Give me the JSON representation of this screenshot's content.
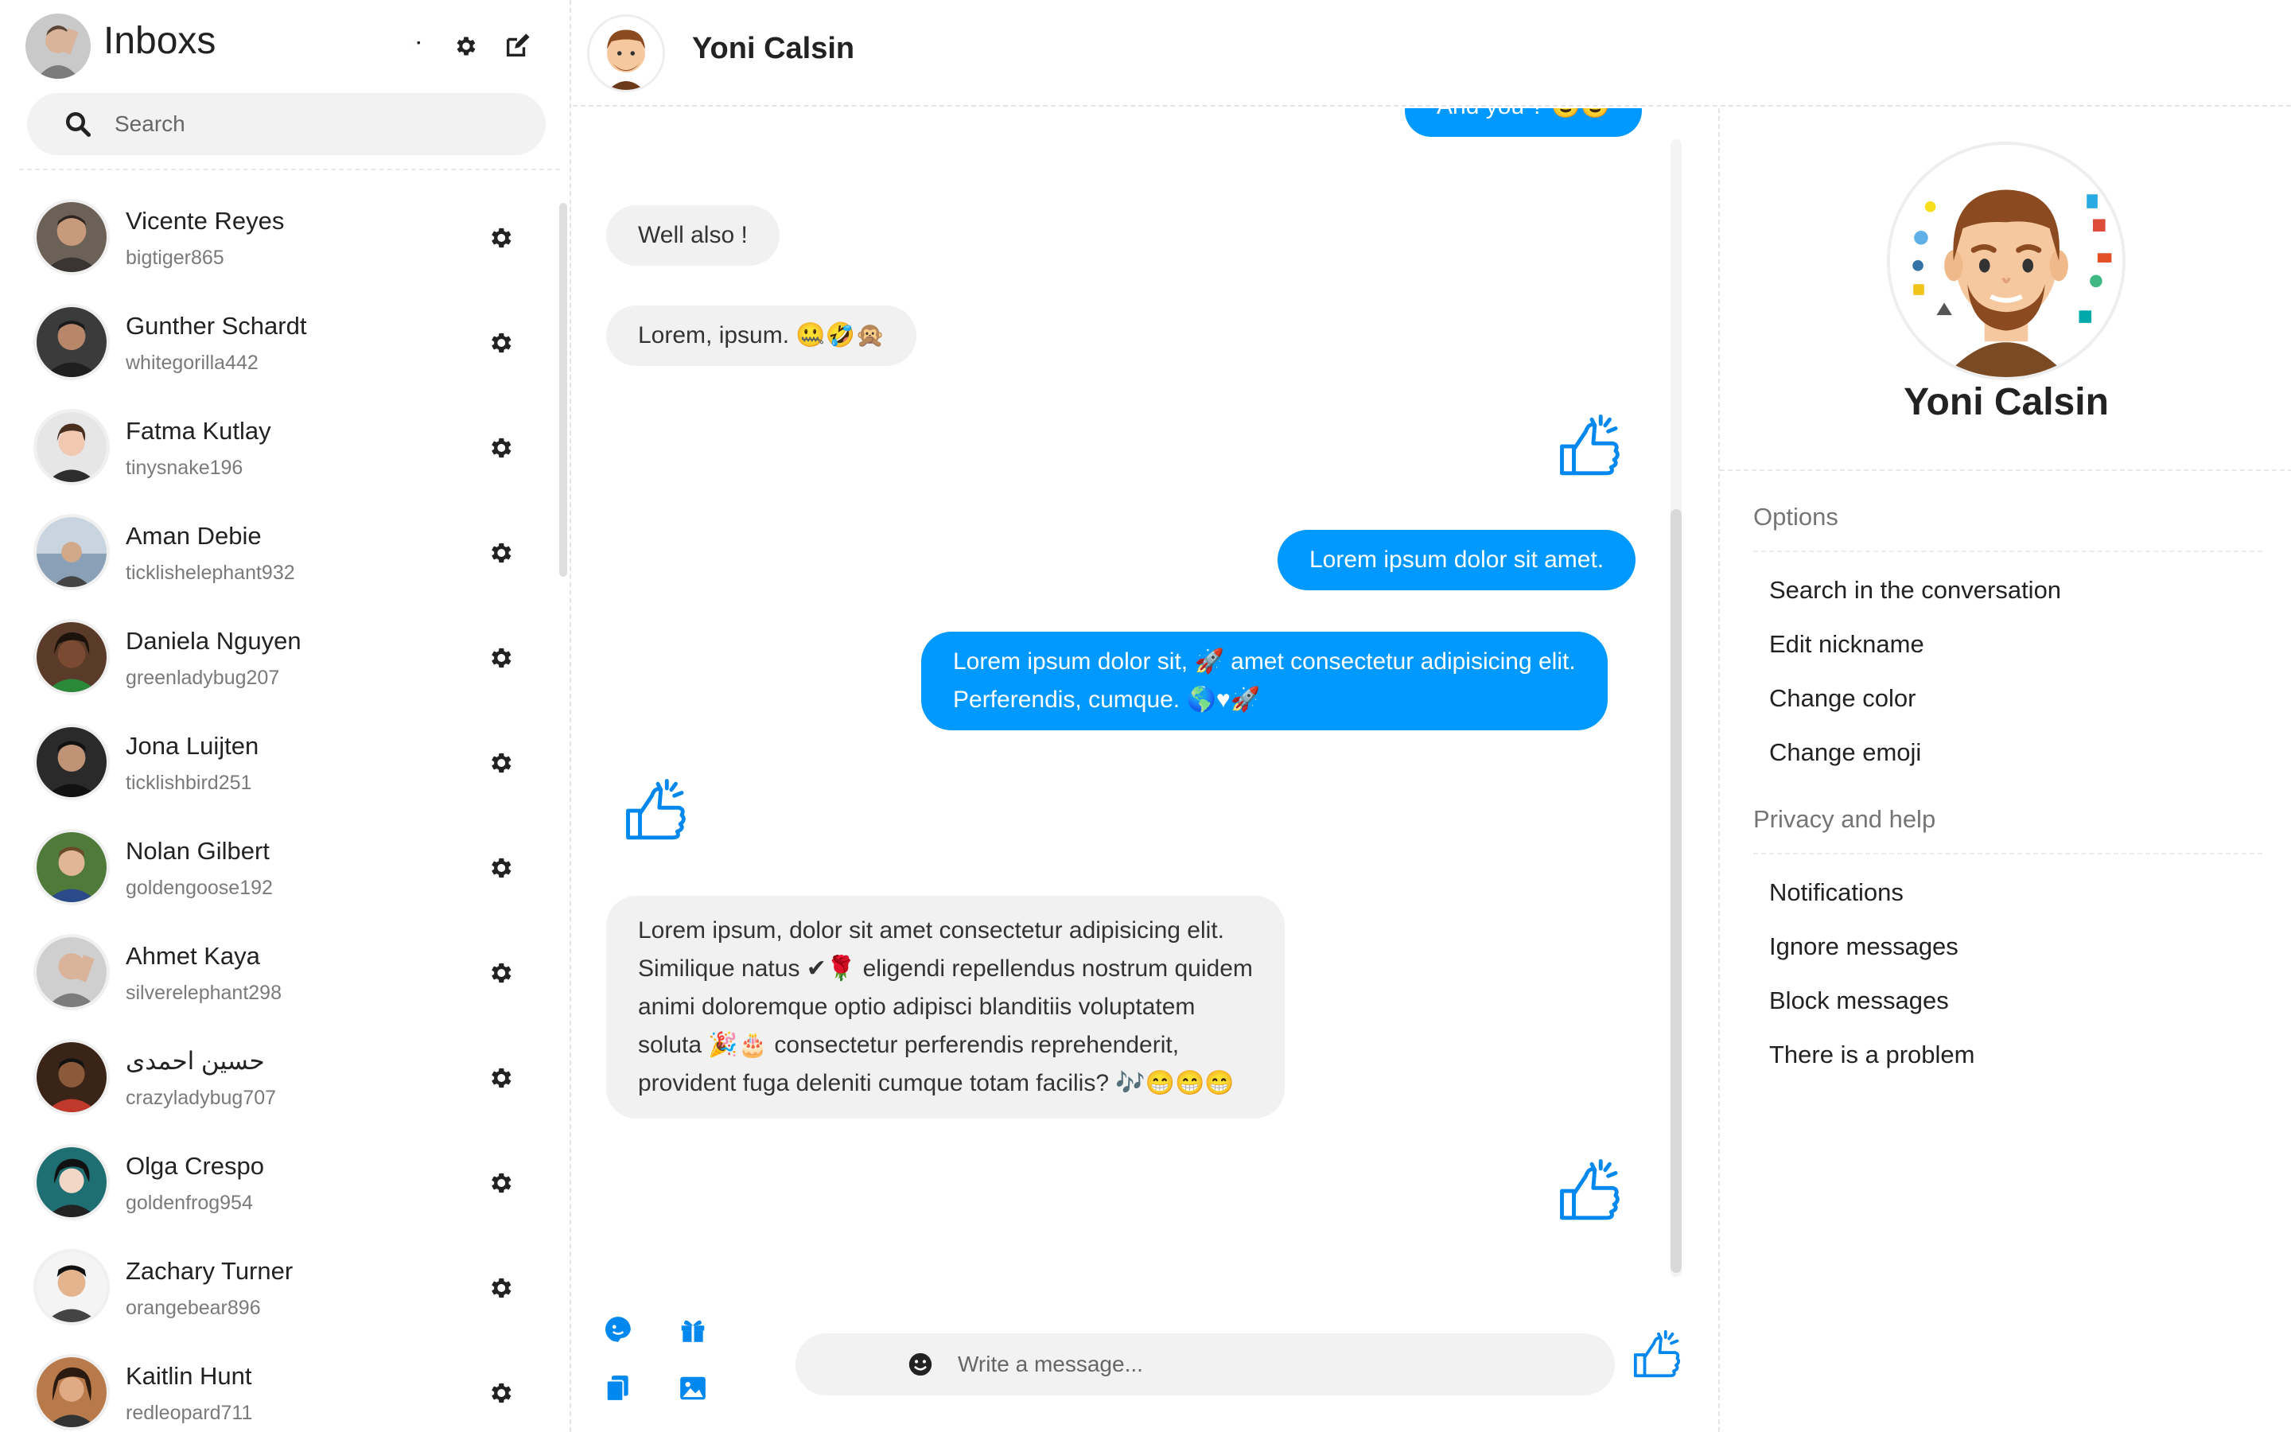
{
  "sidebar": {
    "title": "Inboxs",
    "search_placeholder": "Search",
    "contacts": [
      {
        "name": "Vicente Reyes",
        "username": "bigtiger865"
      },
      {
        "name": "Gunther Schardt",
        "username": "whitegorilla442"
      },
      {
        "name": "Fatma Kutlay",
        "username": "tinysnake196"
      },
      {
        "name": "Aman Debie",
        "username": "ticklishelephant932"
      },
      {
        "name": "Daniela Nguyen",
        "username": "greenladybug207"
      },
      {
        "name": "Jona Luijten",
        "username": "ticklishbird251"
      },
      {
        "name": "Nolan Gilbert",
        "username": "goldengoose192"
      },
      {
        "name": "Ahmet Kaya",
        "username": "silverelephant298"
      },
      {
        "name": "حسين احمدى",
        "username": "crazyladybug707"
      },
      {
        "name": "Olga Crespo",
        "username": "goldenfrog954"
      },
      {
        "name": "Zachary Turner",
        "username": "orangebear896"
      },
      {
        "name": "Kaitlin Hunt",
        "username": "redleopard711"
      }
    ]
  },
  "chat": {
    "contact_name": "Yoni Calsin",
    "messages": [
      {
        "dir": "out",
        "text": "And you ? 😉😉"
      },
      {
        "dir": "in",
        "text": "Well also !"
      },
      {
        "dir": "in",
        "text": "Lorem, ipsum. 🤐🤣🙊"
      },
      {
        "dir": "out",
        "text": "Lorem ipsum dolor sit amet."
      },
      {
        "dir": "out",
        "lines": [
          "Lorem ipsum dolor sit, 🚀 amet consectetur adipisicing elit.",
          "Perferendis, cumque. 🌎♥🚀"
        ]
      },
      {
        "dir": "in",
        "lines": [
          "Lorem ipsum, dolor sit amet consectetur adipisicing elit.",
          "Similique natus ✔🌹 eligendi repellendus nostrum quidem",
          "animi doloremque optio adipisci blanditiis voluptatem",
          "soluta 🎉🎂 consectetur perferendis reprehenderit,",
          "provident fuga deleniti cumque totam facilis? 🎶😁😁😁"
        ]
      }
    ],
    "composer_placeholder": "Write a message..."
  },
  "info": {
    "name": "Yoni Calsin",
    "sections": [
      {
        "title": "Options",
        "items": [
          "Search in the conversation",
          "Edit nickname",
          "Change color",
          "Change emoji"
        ]
      },
      {
        "title": "Privacy and help",
        "items": [
          "Notifications",
          "Ignore messages",
          "Block messages",
          "There is a problem"
        ]
      }
    ]
  },
  "colors": {
    "accent": "#0099ff",
    "bubble_in": "#f1f1f1",
    "text": "#222222",
    "muted": "#7a7a7a"
  },
  "icons": [
    "moon-icon",
    "gear-icon",
    "compose-icon",
    "search-icon",
    "thumbs-up-icon",
    "sticker-icon",
    "gift-icon",
    "file-icon",
    "image-icon",
    "smile-icon"
  ]
}
